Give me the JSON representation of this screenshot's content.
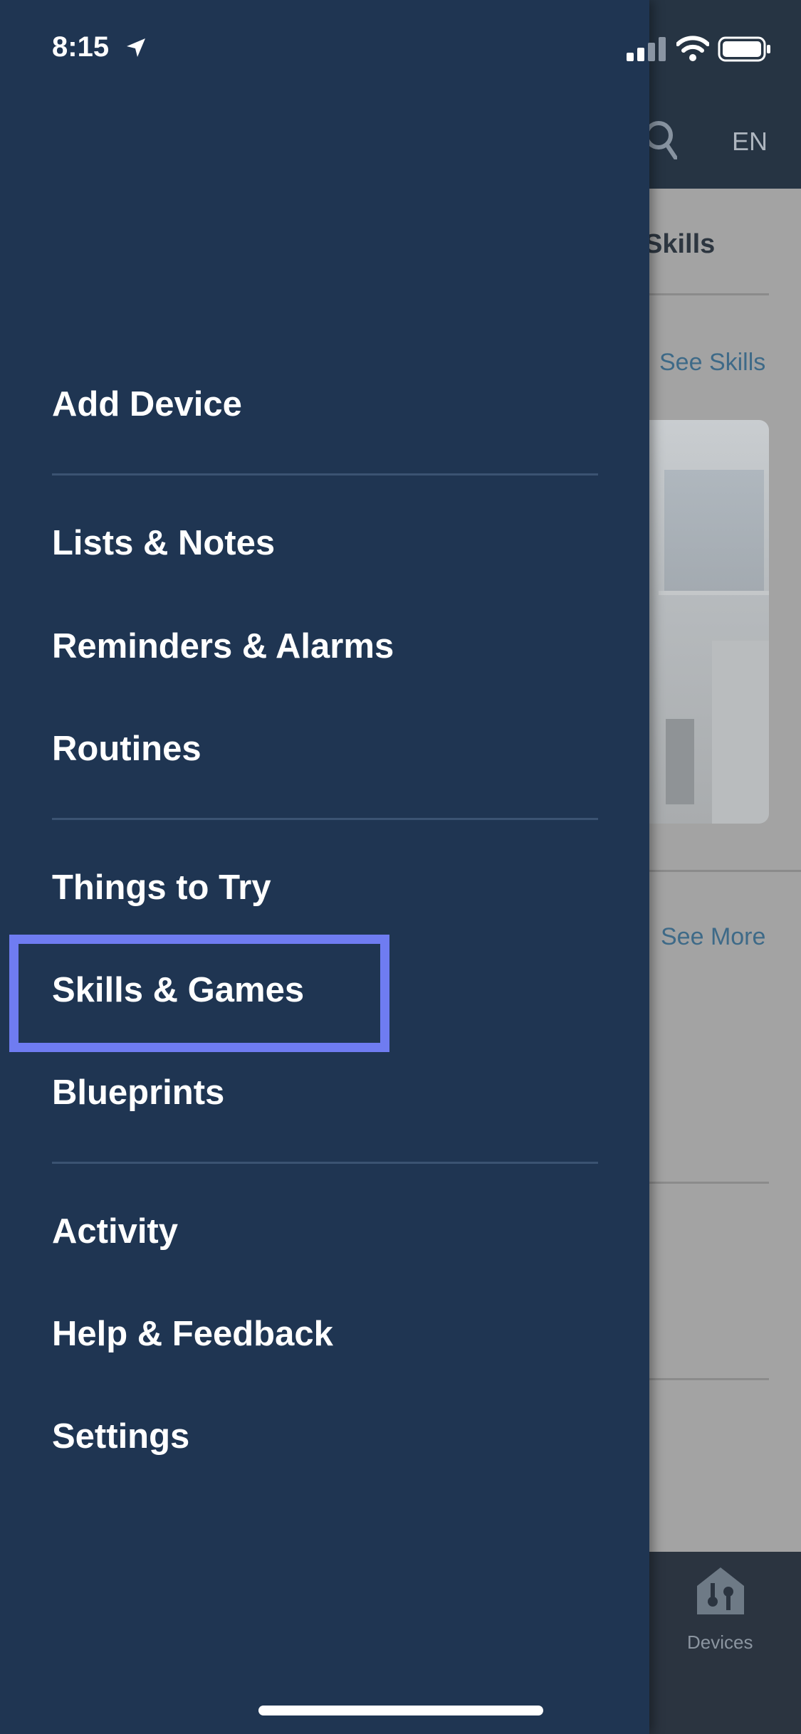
{
  "status_bar": {
    "time": "8:15"
  },
  "background": {
    "language": "EN",
    "section_title": "Skills",
    "see_skills": "See Skills",
    "see_more": "See More",
    "tab_devices": "Devices"
  },
  "menu": {
    "items": [
      {
        "label": "Add Device"
      },
      {
        "label": "Lists & Notes"
      },
      {
        "label": "Reminders & Alarms"
      },
      {
        "label": "Routines"
      },
      {
        "label": "Things to Try"
      },
      {
        "label": "Skills & Games",
        "highlighted": true
      },
      {
        "label": "Blueprints"
      },
      {
        "label": "Activity"
      },
      {
        "label": "Help & Feedback"
      },
      {
        "label": "Settings"
      }
    ]
  },
  "colors": {
    "drawer_bg": "#1f3552",
    "highlight": "#6f7cf1",
    "divider": "#3b5372"
  }
}
